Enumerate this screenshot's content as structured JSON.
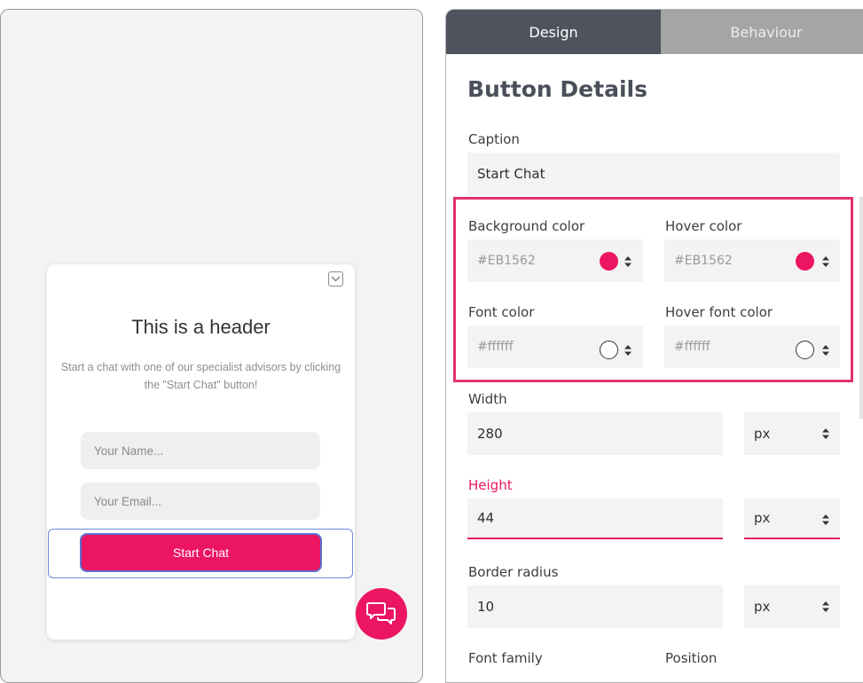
{
  "preview": {
    "header": "This is a header",
    "subtext": "Start a chat with one of our specialist advisors by clicking the \"Start Chat\" button!",
    "name_placeholder": "Your Name...",
    "email_placeholder": "Your Email...",
    "button_label": "Start Chat",
    "icons": {
      "minimize": "chevron-down-icon",
      "chat": "chat-bubbles-icon"
    }
  },
  "tabs": [
    {
      "label": "Design",
      "active": true
    },
    {
      "label": "Behaviour",
      "active": false
    }
  ],
  "section_title": "Button Details",
  "fields": {
    "caption": {
      "label": "Caption",
      "value": "Start Chat"
    },
    "background_color": {
      "label": "Background color",
      "value": "#EB1562",
      "swatch": "#eb1562"
    },
    "hover_color": {
      "label": "Hover color",
      "value": "#EB1562",
      "swatch": "#eb1562"
    },
    "font_color": {
      "label": "Font color",
      "value": "#ffffff",
      "swatch": "#ffffff"
    },
    "hover_font_color": {
      "label": "Hover font color",
      "value": "#ffffff",
      "swatch": "#ffffff"
    },
    "width": {
      "label": "Width",
      "value": "280",
      "unit": "px"
    },
    "height": {
      "label": "Height",
      "value": "44",
      "unit": "px"
    },
    "border_radius": {
      "label": "Border radius",
      "value": "10",
      "unit": "px"
    },
    "font_family": {
      "label": "Font family"
    },
    "position": {
      "label": "Position"
    }
  },
  "colors": {
    "accent": "#eb1562",
    "tab_active": "#4f535d",
    "tab_inactive": "#a5a5a5",
    "selection_outline": "#6f87e0"
  }
}
